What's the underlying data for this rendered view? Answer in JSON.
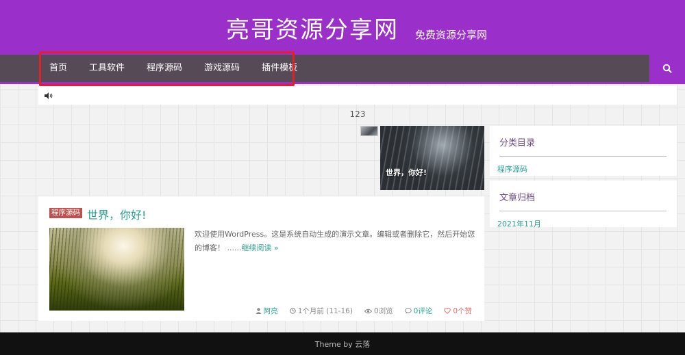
{
  "site": {
    "title": "亮哥资源分享网",
    "description": "免费资源分享网"
  },
  "nav": {
    "items": [
      {
        "label": "首页"
      },
      {
        "label": "工具软件"
      },
      {
        "label": "程序源码"
      },
      {
        "label": "游戏源码"
      },
      {
        "label": "插件模板"
      }
    ],
    "search_icon": "search-icon"
  },
  "notice": {
    "icon": "speaker-icon"
  },
  "pagination": {
    "text": "123"
  },
  "slider": {
    "caption": "世界，你好!"
  },
  "sidebar": {
    "categories": {
      "title": "分类目录",
      "items": [
        {
          "label": "程序源码"
        }
      ]
    },
    "archives": {
      "title": "文章归档",
      "items": [
        {
          "label": "2021年11月"
        }
      ]
    }
  },
  "post": {
    "category": "程序源码",
    "title": "世界，你好!",
    "excerpt": "欢迎使用WordPress。这是系统自动生成的演示文章。编辑或者删除它，然后开始您的博客！ ......",
    "read_more": "继续阅读 »",
    "meta": {
      "author": "阿亮",
      "time": "1个月前 (11-16)",
      "views": "0浏览",
      "comments": "0评论",
      "likes": "0个赞"
    }
  },
  "footer": {
    "text": "Theme by 云落"
  },
  "colors": {
    "header": "#9b2fc9",
    "navbar": "#564a57",
    "accent": "#27a090",
    "tag": "#c0504d",
    "highlight": "#e0202a"
  }
}
